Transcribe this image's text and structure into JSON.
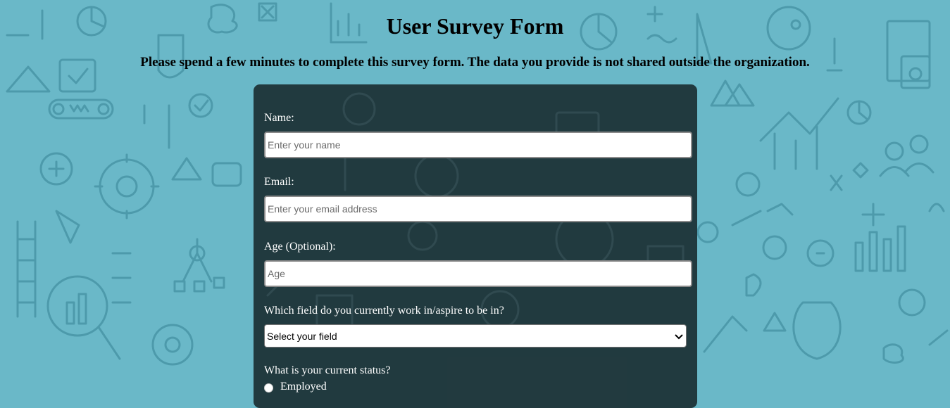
{
  "page": {
    "title": "User Survey Form",
    "description": "Please spend a few minutes to complete this survey form. The data you provide is not shared outside the organization."
  },
  "form": {
    "name": {
      "label": "Name:",
      "placeholder": "Enter your name",
      "value": ""
    },
    "email": {
      "label": "Email:",
      "placeholder": "Enter your email address",
      "value": ""
    },
    "age": {
      "label": "Age (Optional):",
      "placeholder": "Age",
      "value": ""
    },
    "field": {
      "label": "Which field do you currently work in/aspire to be in?",
      "selected": "Select your field"
    },
    "status": {
      "label": "What is your current status?",
      "options": [
        "Employed"
      ]
    }
  },
  "colors": {
    "background": "#6ab8c8",
    "card": "#1c3035",
    "doodle": "#4d9aab"
  },
  "icons": {
    "background": "doodle-pattern",
    "select_arrow": "chevron-down-icon"
  }
}
